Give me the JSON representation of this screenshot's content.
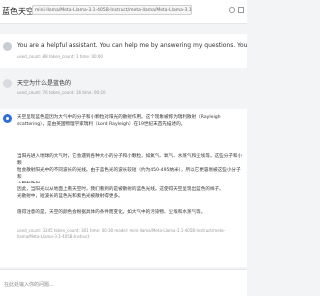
{
  "header": {
    "title": "蓝色天空",
    "model": "mini-llama/Meta-Llama-3.1-405B-Instruct/meta-llama/Meta-Llama-3.1-405B-Instruct",
    "icons": [
      "gear-icon",
      "expand-icon"
    ]
  },
  "messages": [
    {
      "role": "system",
      "text": "You are a helpful assistant. You can help me by answering my questions. You can also ask me questions.",
      "meta": "used_count: 88   token_count: 1   time: 00:00"
    },
    {
      "role": "user",
      "text": "天空为什么是蓝色的",
      "meta": "used_count: 76   token_count: 16   time: 00:20"
    },
    {
      "role": "assistant",
      "paragraphs": [
        "天空呈现蓝色是因为大气中的分子和小颗粒对阳光的散射作用。这个现象被称为瑞利散射（Rayleigh\nscattering），是由英国物理学家瑞利（Lord Rayleigh）在19世纪末首先描述的。",
        "当阳光进入地球的大气时，它会遇到各种大小的分子和小颗粒，如氮气、氧气、水蒸气和尘埃等。这些分子和小颗\n粒会散射阳光中的不同波长的光线。由于蓝色光的波长较短（约为450-495纳米），所以它更容易被这些小分子和\n小颗粒散射。",
        "因此，当阳光以从地面上看天空时，我们看到的是被散射的蓝色光线。这使得天空呈现出蓝色的样子。\n光散射中，短波长的蓝色光和紫色光被散射得更多。",
        "值得注意的是，天空的颜色会根据具体的条件而变化，如大气中的污染物、尘埃和水蒸气等。"
      ],
      "meta": "used_count: 3245   token_count: 301   time: 00:30   model: mini-llama/Meta-Llama-3.1-405B-Instruct/meta-llama/Meta-Llama-3.1-405B-Instruct"
    }
  ],
  "input": {
    "placeholder": "在此处输入你的问题..."
  }
}
